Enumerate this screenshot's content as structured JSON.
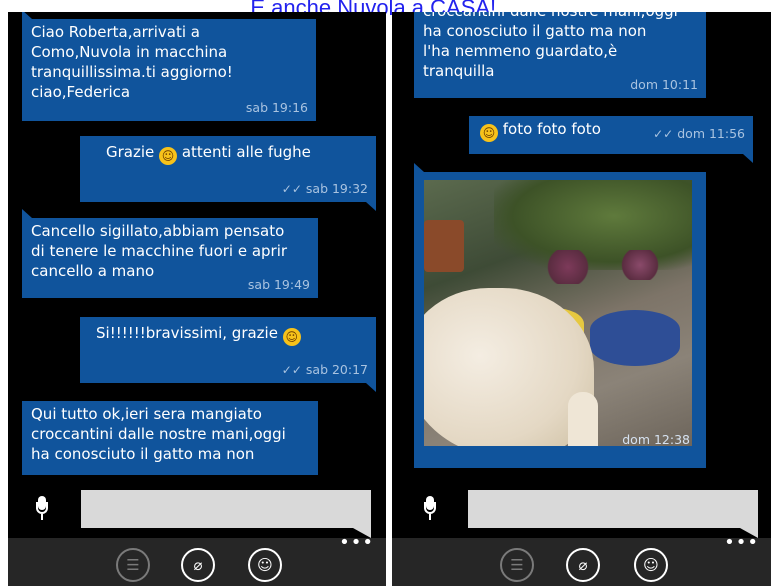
{
  "caption": "E anche Nuvola a CASA!....",
  "left_phone": {
    "messages": [
      {
        "dir": "in",
        "text": "Ciao Roberta,arrivati a\nComo,Nuvola in macchina\ntranquillissima.ti aggiorno!\nciao,Federica",
        "time": "sab 19:16"
      },
      {
        "dir": "out",
        "text": "Grazie",
        "emoji": "☺",
        "text_after": "attenti alle fughe",
        "time": "sab 19:32",
        "ticks": "✓✓"
      },
      {
        "dir": "in",
        "text": "Cancello sigillato,abbiam pensato\ndi tenere le macchine fuori e aprir\ncancello a mano",
        "time": "sab 19:49"
      },
      {
        "dir": "out",
        "text": "Si!!!!!!bravissimi, grazie",
        "emoji": "☺",
        "time": "sab 20:17",
        "ticks": "✓✓"
      },
      {
        "dir": "in",
        "text": "Qui tutto ok,ieri sera mangiato\ncroccantini dalle nostre mani,oggi\nha conosciuto il gatto ma non"
      }
    ],
    "input_placeholder": ""
  },
  "right_phone": {
    "messages": [
      {
        "dir": "in",
        "text": "croccantini dalle nostre mani,oggi\nha conosciuto il gatto ma non\nl'ha nemmeno guardato,è\ntranquilla",
        "time": "dom 10:11"
      },
      {
        "dir": "out",
        "emoji": "☺",
        "text": "foto foto foto",
        "time": "dom 11:56",
        "ticks": "✓✓"
      },
      {
        "dir": "in",
        "type": "photo",
        "time": "dom 12:38"
      }
    ],
    "input_placeholder": ""
  },
  "appbar": {
    "buttons": [
      {
        "name": "chat-icon",
        "glyph": "☰"
      },
      {
        "name": "attach-icon",
        "glyph": "⌀"
      },
      {
        "name": "smiley-icon",
        "glyph": "☺"
      }
    ],
    "more": "•••"
  },
  "colors": {
    "bubble": "#10549c",
    "meta_text": "#a9c3e0",
    "caption": "#2222ee",
    "appbar": "#262626"
  }
}
